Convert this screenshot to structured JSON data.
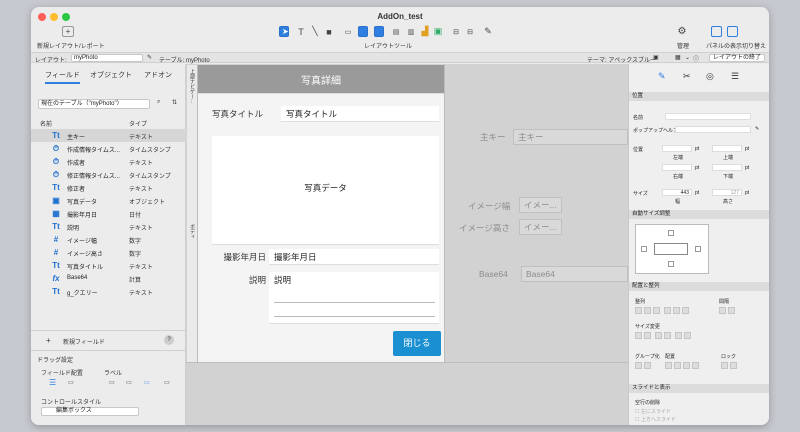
{
  "window": {
    "title": "AddOn_test"
  },
  "toolbar": {
    "new_layout": "新規レイアウト/レポート",
    "layout_tools": "レイアウトツール",
    "manage": "管理",
    "panel_toggle": "パネルの表示切り替え",
    "exit_layout": "レイアウトの終了"
  },
  "layout_bar": {
    "layout_label": "レイアウト:",
    "layout_value": "myPhoto",
    "table_label": "テーブル: myPhoto",
    "theme_label": "テーマ: アペックスブルー",
    "zoom_value": "100"
  },
  "left_panel": {
    "tabs": [
      "フィールド",
      "オブジェクト",
      "アドオン"
    ],
    "table_selector": "現在のテーブル（\"myPhoto\"）",
    "col_name": "名前",
    "col_type": "タイプ",
    "fields": [
      {
        "icon": "Tt",
        "name": "主キー",
        "type": "テキスト"
      },
      {
        "icon": "⏱",
        "name": "作成情報タイムス...",
        "type": "タイムスタンプ"
      },
      {
        "icon": "⏱",
        "name": "作成者",
        "type": "テキスト"
      },
      {
        "icon": "⏱",
        "name": "修正情報タイムス...",
        "type": "タイムスタンプ"
      },
      {
        "icon": "Tt",
        "name": "修正者",
        "type": "テキスト"
      },
      {
        "icon": "▣",
        "name": "写真データ",
        "type": "オブジェクト"
      },
      {
        "icon": "▦",
        "name": "撮影年月日",
        "type": "日付"
      },
      {
        "icon": "Tt",
        "name": "説明",
        "type": "テキスト"
      },
      {
        "icon": "#",
        "name": "イメージ幅",
        "type": "数字"
      },
      {
        "icon": "#",
        "name": "イメージ高さ",
        "type": "数字"
      },
      {
        "icon": "Tt",
        "name": "写真タイトル",
        "type": "テキスト"
      },
      {
        "icon": "fx",
        "name": "Base64",
        "type": "計算"
      },
      {
        "icon": "Tt",
        "name": "g_クエリー",
        "type": "テキスト"
      }
    ],
    "new_field": "新規フィールド",
    "help": "?",
    "drag_settings": "ドラッグ設定",
    "field_placement": "フィールド配置",
    "label": "ラベル",
    "control_style": "コントロールスタイル",
    "control_style_value": "編集ボックス"
  },
  "form": {
    "header": "写真詳細",
    "header_band": "上部ナビゲー...",
    "body_band": "ボディ",
    "title_label": "写真タイトル",
    "title_value": "写真タイトル",
    "photo_data": "写真データ",
    "date_label": "撮影年月日",
    "date_value": "撮影年月日",
    "desc_label": "説明",
    "desc_value": "説明",
    "close_button": "閉じる"
  },
  "offscreen": {
    "primary_key_label": "主キー",
    "primary_key_value": "主キー",
    "width_label": "イメージ幅",
    "width_value": "イメー...",
    "height_label": "イメージ高さ",
    "height_value": "イメー...",
    "base64_label": "Base64",
    "base64_value": "Base64"
  },
  "inspector": {
    "position_section": "位置",
    "name_label": "名前",
    "popover_help": "ポップアップヘルプ",
    "position_label": "位置",
    "pt_unit": "pt",
    "left": "左端",
    "top": "上端",
    "right": "右端",
    "bottom": "下端",
    "size_label": "サイズ",
    "width_val": "443",
    "height_val": "127",
    "width": "幅",
    "height": "高さ",
    "autosize_section": "自動サイズ調整",
    "arrange_section": "配置と整列",
    "align_label": "整列",
    "spacing_label": "間隔",
    "resize_label": "サイズ変更",
    "group_label": "グループ化",
    "arrange_label": "配置",
    "lock_label": "ロック",
    "slide_section": "スライドと表示",
    "slide_remove": "空行の削除",
    "slide_left": "左にスライド",
    "slide_up": "上方へスライド"
  },
  "colors": {
    "accent": "#1a8fd1",
    "close_button": "#1a8fd1",
    "form_header": "#9a9a9a"
  }
}
